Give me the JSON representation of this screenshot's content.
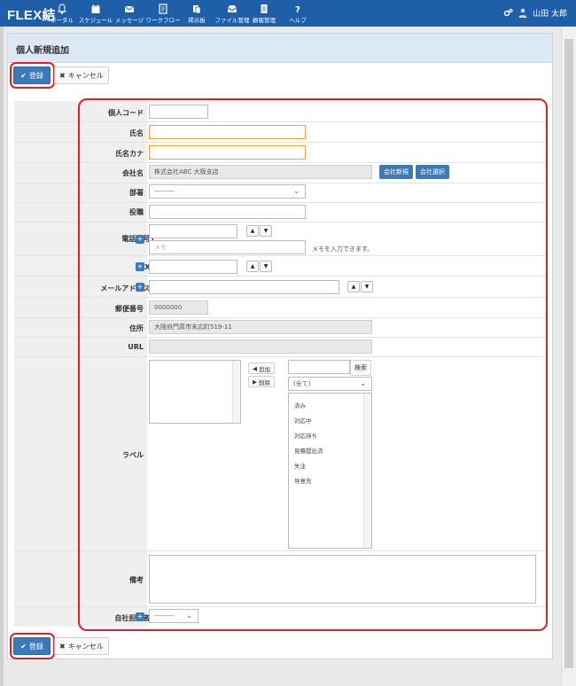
{
  "app": {
    "logo": "FLEX結"
  },
  "nav": [
    {
      "label": "ポータル",
      "icon": "bell-icon"
    },
    {
      "label": "スケジュール",
      "icon": "calendar-icon"
    },
    {
      "label": "メッセージ",
      "icon": "envelope-icon"
    },
    {
      "label": "ワークフロー",
      "icon": "workflow-icon"
    },
    {
      "label": "掲示板",
      "icon": "board-icon"
    },
    {
      "label": "ファイル管理",
      "icon": "inbox-icon"
    },
    {
      "label": "顧客管理",
      "icon": "document-icon"
    },
    {
      "label": "ヘルプ",
      "icon": "question-icon"
    }
  ],
  "user": {
    "name": "山田 太郎"
  },
  "page": {
    "title": "個人新規追加"
  },
  "buttons": {
    "register": "登録",
    "cancel": "キャンセル"
  },
  "form": {
    "personal_code": {
      "label": "個人コード",
      "value": ""
    },
    "name": {
      "label": "氏名",
      "value": ""
    },
    "name_kana": {
      "label": "氏名カナ",
      "value": ""
    },
    "company": {
      "label": "会社名",
      "value": "株式会社ABC 大阪支店",
      "new_button": "会社新規",
      "select_button": "会社選択"
    },
    "department": {
      "label": "部署",
      "value": "---------"
    },
    "position": {
      "label": "役職",
      "value": ""
    },
    "phone": {
      "label": "電話番号1",
      "value": "",
      "memo_placeholder": "メモ",
      "memo_hint": "メモを入力できます。"
    },
    "fax": {
      "label": "FAX1",
      "value": ""
    },
    "email": {
      "label": "メールアドレス1",
      "value": ""
    },
    "postal": {
      "label": "郵便番号",
      "value": "0000000"
    },
    "address": {
      "label": "住所",
      "value": "大阪府門真市末広町519-11"
    },
    "url": {
      "label": "URL",
      "value": ""
    },
    "labels": {
      "label": "ラベル",
      "add_button": "追加",
      "remove_button": "削除",
      "search_button": "検索",
      "filter_value": "(全て)",
      "options": [
        "済み",
        "対応中",
        "対応待ち",
        "見積提出済",
        "失注",
        "导意先"
      ]
    },
    "remarks": {
      "label": "備考",
      "value": ""
    },
    "staff": {
      "label": "自社担当者1",
      "value": "---------"
    }
  },
  "colors": {
    "header": "#1f5fa8",
    "primary": "#3a7ab8",
    "highlight": "#e02020",
    "required_border": "#f0a040"
  }
}
